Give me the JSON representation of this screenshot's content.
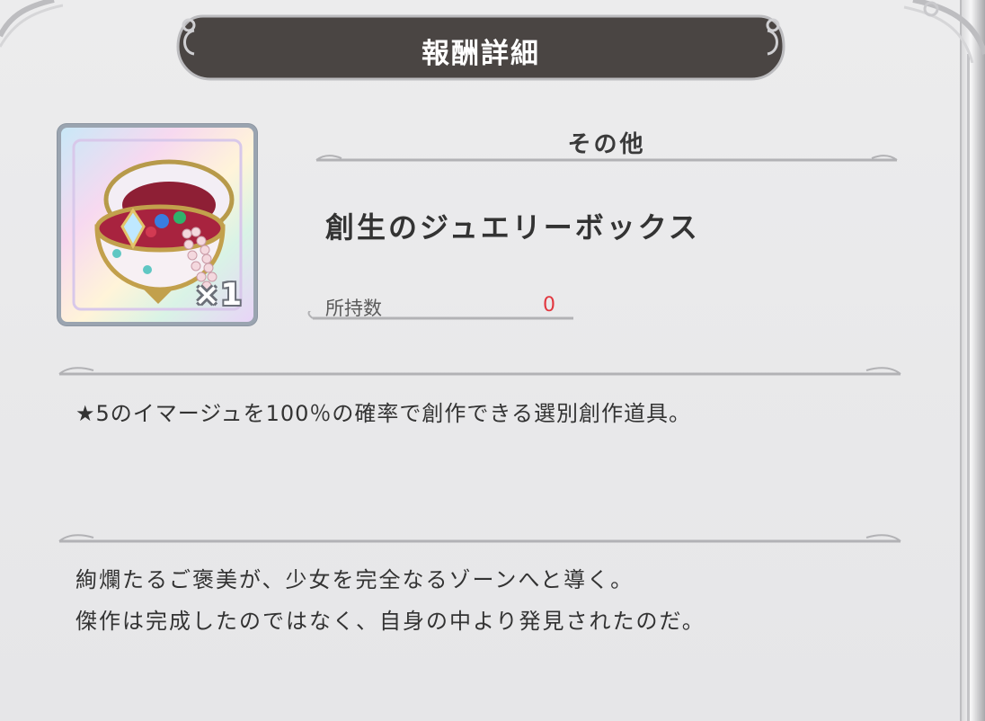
{
  "dialog": {
    "title": "報酬詳細"
  },
  "item": {
    "category": "その他",
    "name": "創生のジュエリーボックス",
    "quantity": "×1",
    "owned_label": "所持数",
    "owned_value": "0",
    "icon": "jewelry-box-icon"
  },
  "description": "★5のイマージュを100％の確率で創作できる選別創作道具。",
  "flavor": {
    "line1": "絢爛たるご褒美が、少女を完全なるゾーンへと導く。",
    "line2": "傑作は完成したのではなく、自身の中より発見されたのだ。"
  },
  "colors": {
    "banner": "#4a4543",
    "owned_value": "#e2373f",
    "panel": "#e9e9ea"
  }
}
